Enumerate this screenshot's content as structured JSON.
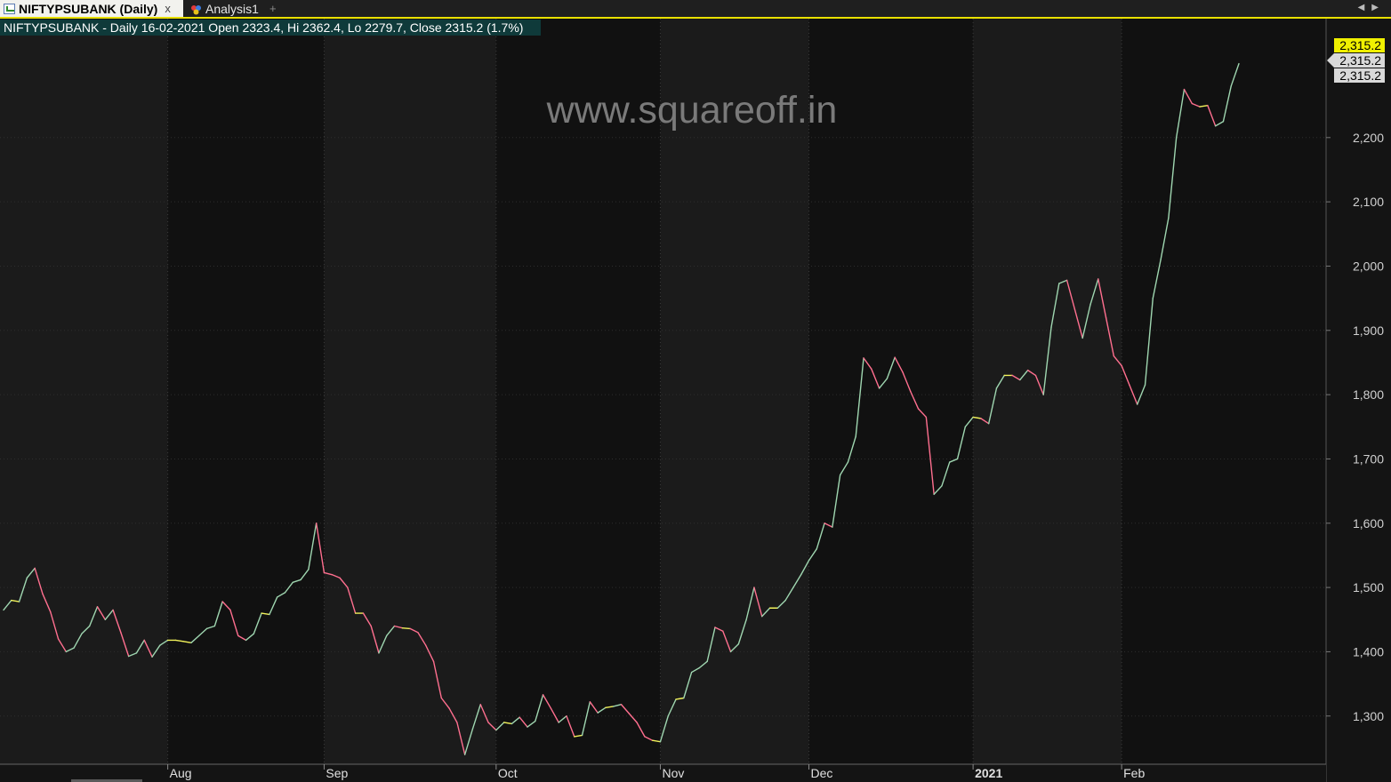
{
  "tabs": [
    {
      "label": "NIFTYPSUBANK (Daily)",
      "icon": "chart-icon",
      "close": "x",
      "active": true
    },
    {
      "label": "Analysis1",
      "icon": "analysis-icon",
      "active": false
    }
  ],
  "tab_add_icon": "+",
  "nav_icons": [
    "scroll-left-icon",
    "scroll-right-icon"
  ],
  "header": {
    "info": "NIFTYPSUBANK - Daily 16-02-2021 Open 2323.4, Hi 2362.4, Lo 2279.7, Close 2315.2 (1.7%)"
  },
  "watermark": "www.squareoff.in",
  "price_labels": [
    "2,315.2",
    "2,315.2",
    "2,315.2"
  ],
  "colors": {
    "up": "#9fd6b0",
    "down": "#ff6f8f",
    "flat": "#f2f25a",
    "label_highlight": "#f0f000",
    "label_normal": "#d9d9d9"
  },
  "chart_data": {
    "type": "line",
    "ylim": [
      1225,
      2385
    ],
    "yticks": [
      1300,
      1400,
      1500,
      1600,
      1700,
      1800,
      1900,
      2000,
      2100,
      2200
    ],
    "ytick_labels": [
      "1,300",
      "1,400",
      "1,500",
      "1,600",
      "1,700",
      "1,800",
      "1,900",
      "2,000",
      "2,100",
      "2,200"
    ],
    "xticks": [
      {
        "label": "Aug",
        "index": 21
      },
      {
        "label": "Sep",
        "index": 41
      },
      {
        "label": "Oct",
        "index": 63
      },
      {
        "label": "Nov",
        "index": 84
      },
      {
        "label": "Dec",
        "index": 103
      },
      {
        "label": "2021",
        "index": 124
      },
      {
        "label": "Feb",
        "index": 143
      }
    ],
    "grid": true,
    "values": [
      1465,
      1480,
      1478,
      1515,
      1530,
      1490,
      1462,
      1420,
      1400,
      1406,
      1428,
      1440,
      1470,
      1450,
      1465,
      1430,
      1393,
      1398,
      1418,
      1392,
      1410,
      1418,
      1418,
      1416,
      1414,
      1425,
      1436,
      1440,
      1478,
      1465,
      1425,
      1418,
      1428,
      1460,
      1458,
      1485,
      1492,
      1508,
      1512,
      1528,
      1600,
      1523,
      1520,
      1515,
      1500,
      1460,
      1460,
      1440,
      1398,
      1425,
      1440,
      1437,
      1436,
      1430,
      1410,
      1385,
      1328,
      1312,
      1290,
      1240,
      1280,
      1318,
      1290,
      1278,
      1290,
      1288,
      1298,
      1283,
      1292,
      1333,
      1312,
      1290,
      1300,
      1268,
      1270,
      1322,
      1305,
      1313,
      1315,
      1318,
      1304,
      1290,
      1268,
      1262,
      1260,
      1300,
      1326,
      1328,
      1368,
      1375,
      1385,
      1438,
      1432,
      1400,
      1412,
      1450,
      1500,
      1455,
      1468,
      1468,
      1480,
      1500,
      1520,
      1542,
      1560,
      1600,
      1594,
      1675,
      1695,
      1735,
      1857,
      1840,
      1810,
      1825,
      1858,
      1835,
      1805,
      1778,
      1765,
      1645,
      1658,
      1695,
      1700,
      1750,
      1765,
      1763,
      1755,
      1810,
      1830,
      1830,
      1823,
      1838,
      1830,
      1800,
      1905,
      1973,
      1978,
      1933,
      1888,
      1940,
      1980,
      1920,
      1860,
      1845,
      1815,
      1785,
      1815,
      1950,
      2010,
      2075,
      2200,
      2275,
      2253,
      2248,
      2250,
      2218,
      2225,
      2280,
      2315
    ]
  }
}
